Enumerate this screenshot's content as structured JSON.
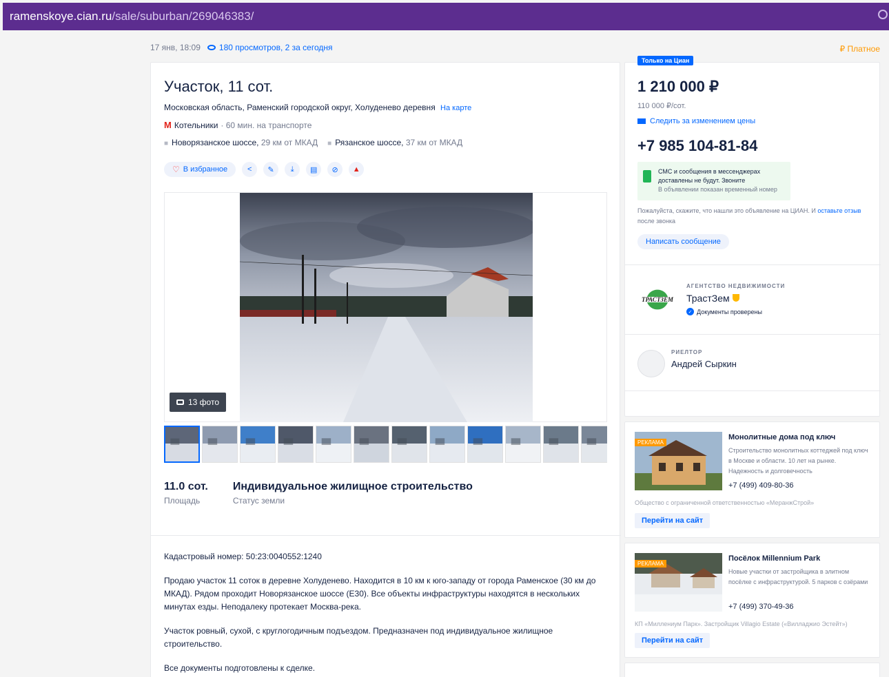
{
  "url": {
    "host": "ramenskoye.cian.ru",
    "path": "/sale/suburban/269046383/"
  },
  "meta": {
    "date": "17 янв, 18:09",
    "views": "180 просмотров, 2 за сегодня",
    "paid": "₽  Платное"
  },
  "listing": {
    "title": "Участок, 11 сот.",
    "address": "Московская область, Раменский городской округ, Холуденево деревня",
    "map_link": "На карте",
    "metro": "Котельники",
    "metro_time": "· 60 мин. на транспорте",
    "roads": [
      {
        "name": "Новорязанское шоссе,",
        "dist": "29 км от МКАД"
      },
      {
        "name": "Рязанское шоссе,",
        "dist": "37 км от МКАД"
      }
    ],
    "fav_label": "В избранное",
    "photo_count": "13 фото",
    "facts": [
      {
        "value": "11.0 сот.",
        "label": "Площадь"
      },
      {
        "value": "Индивидуальное жилищное строительство",
        "label": "Статус земли"
      }
    ],
    "description": [
      "Кадастровый номер: 50:23:0040552:1240",
      "Продаю участок 11 соток в деревне Холуденево. Находится в 10 км к юго-западу от города Раменское (30 км до МКАД). Рядом проходит Новорязанское шоссе (Е30). Все объекты инфраструктуры находятся в нескольких минутах езды. Неподалеку протекает Москва-река.",
      "Участок ровный, сухой, с круглогодичным подъездом. Предназначен под индивидуальное жилищное строительство.",
      "Все документы подготовлены к сделке."
    ]
  },
  "sidebar": {
    "only_badge": "Только на Циан",
    "price": "1 210 000 ₽",
    "price_per": "110 000 ₽/сот.",
    "track": "Следить за изменением цены",
    "phone": "+7 985 104-81-84",
    "sms_line1": "СМС и сообщения в мессенджерах",
    "sms_line2": "доставлены не будут. Звоните",
    "sms_line3": "В объявлении показан временный номер",
    "note_text": "Пожалуйста, скажите, что нашли это объявление на ЦИАН. И",
    "note_link": "оставьте отзыв",
    "note_end": "после звонка",
    "write_button": "Написать сообщение",
    "agency_kind": "АГЕНТСТВО НЕДВИЖИМОСТИ",
    "agency_name": "ТрастЗем",
    "agency_logo_text": "ТРАСТЗЕМ",
    "agency_docs": "Документы проверены",
    "realtor_kind": "РИЕЛТОР",
    "realtor_name": "Андрей Сыркин"
  },
  "ads": [
    {
      "tag": "РЕКЛАМА",
      "title": "Монолитные дома под ключ",
      "text": "Строительство монолитных коттеджей под ключ в Москве и области. 10 лет на рынке. Надежность и долговечность",
      "phone": "+7 (499) 409-80-36",
      "company": "Общество с ограниченной ответственностью «МеранжСтрой»",
      "button": "Перейти на сайт"
    },
    {
      "tag": "РЕКЛАМА",
      "title": "Посёлок Millennium Park",
      "text": "Новые участки от застройщика в элитном посёлке с инфраструктурой. 5 парков с озёрами",
      "phone": "+7 (499) 370-49-36",
      "company": "КП «Миллениум Парк». Застройщик Villagio Estate («Вилладжио Эстейт»)",
      "button": "Перейти на сайт"
    }
  ],
  "colors": {
    "accent": "#0468ff",
    "browser_bar": "#5c2d8f",
    "price_warning": "#ff9900",
    "metro": "#e2231a"
  },
  "icons": [
    "eye-icon",
    "heart-icon",
    "share-icon",
    "edit-icon",
    "download-icon",
    "print-icon",
    "hide-icon",
    "report-icon",
    "camera-icon",
    "envelope-icon",
    "phone-icon",
    "shield-icon",
    "verified-icon",
    "avatar-icon"
  ]
}
